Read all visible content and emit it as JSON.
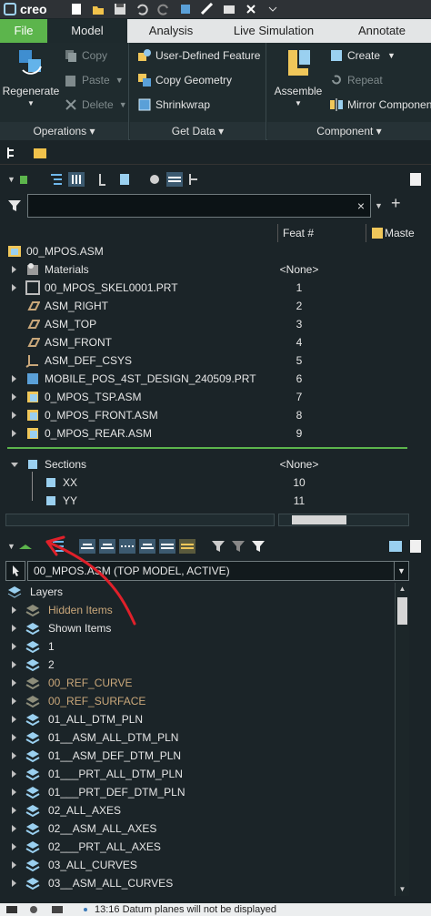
{
  "app": {
    "name": "creo"
  },
  "tabs": [
    "File",
    "Model",
    "Analysis",
    "Live Simulation",
    "Annotate"
  ],
  "ribbon": {
    "operations": {
      "regenerate": "Regenerate",
      "copy": "Copy",
      "paste": "Paste",
      "delete": "Delete",
      "label": "Operations"
    },
    "get_data": {
      "udf": "User-Defined Feature",
      "copy_geometry": "Copy Geometry",
      "shrinkwrap": "Shrinkwrap",
      "label": "Get Data"
    },
    "component": {
      "assemble": "Assemble",
      "create": "Create",
      "repeat": "Repeat",
      "mirror": "Mirror Componen",
      "label": "Component"
    }
  },
  "tree": {
    "search_placeholder": "",
    "clear_glyph": "×",
    "plus_glyph": "+",
    "col_feat": "Feat #",
    "col_master": "Maste",
    "root": "00_MPOS.ASM",
    "items": [
      {
        "label": "Materials",
        "feat": "<None>"
      },
      {
        "label": "00_MPOS_SKEL0001.PRT",
        "feat": "1"
      },
      {
        "label": "ASM_RIGHT",
        "feat": "2"
      },
      {
        "label": "ASM_TOP",
        "feat": "3"
      },
      {
        "label": "ASM_FRONT",
        "feat": "4"
      },
      {
        "label": "ASM_DEF_CSYS",
        "feat": "5"
      },
      {
        "label": "MOBILE_POS_4ST_DESIGN_240509.PRT",
        "feat": "6"
      },
      {
        "label": "0_MPOS_TSP.ASM",
        "feat": "7"
      },
      {
        "label": "0_MPOS_FRONT.ASM",
        "feat": "8"
      },
      {
        "label": "0_MPOS_REAR.ASM",
        "feat": "9"
      }
    ],
    "sections": {
      "label": "Sections",
      "feat": "<None>",
      "children": [
        {
          "label": "XX",
          "feat": "10"
        },
        {
          "label": "YY",
          "feat": "11"
        }
      ]
    }
  },
  "layers": {
    "model_select": "00_MPOS.ASM (TOP MODEL, ACTIVE)",
    "header": "Layers",
    "items": [
      {
        "label": "Hidden Items",
        "hidden": true
      },
      {
        "label": "Shown Items",
        "hidden": false
      },
      {
        "label": "1",
        "hidden": false
      },
      {
        "label": "2",
        "hidden": false
      },
      {
        "label": "00_REF_CURVE",
        "hidden": true
      },
      {
        "label": "00_REF_SURFACE",
        "hidden": true
      },
      {
        "label": "01_ALL_DTM_PLN",
        "hidden": false
      },
      {
        "label": "01__ASM_ALL_DTM_PLN",
        "hidden": false
      },
      {
        "label": "01__ASM_DEF_DTM_PLN",
        "hidden": false
      },
      {
        "label": "01___PRT_ALL_DTM_PLN",
        "hidden": false
      },
      {
        "label": "01___PRT_DEF_DTM_PLN",
        "hidden": false
      },
      {
        "label": "02_ALL_AXES",
        "hidden": false
      },
      {
        "label": "02__ASM_ALL_AXES",
        "hidden": false
      },
      {
        "label": "02___PRT_ALL_AXES",
        "hidden": false
      },
      {
        "label": "03_ALL_CURVES",
        "hidden": false
      },
      {
        "label": "03__ASM_ALL_CURVES",
        "hidden": false
      }
    ]
  },
  "status": {
    "message": "13:16 Datum planes will not be displayed"
  },
  "colors": {
    "accent_green": "#5cb54c",
    "hidden_text": "#c9a77a",
    "annotation_red": "#e0202a"
  }
}
